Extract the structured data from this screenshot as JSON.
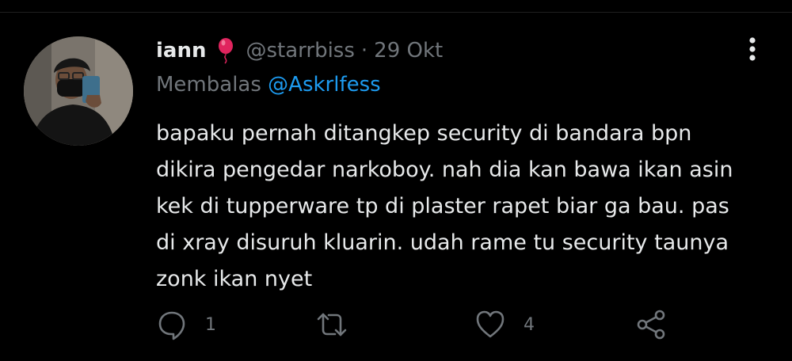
{
  "tweet": {
    "display_name": "iann",
    "handle": "@starrbiss",
    "separator": "·",
    "time": "29 Okt",
    "reply_prefix": "Membalas",
    "reply_to": "@Askrlfess",
    "text": "bapaku pernah ditangkep security di bandara bpn\ndikira pengedar narkoboy. nah dia kan bawa ikan asin\nkek di tupperware tp di plaster rapet biar ga bau. pas\ndi xray disuruh kluarin. udah rame tu security taunya\nzonk ikan nyet"
  },
  "actions": {
    "reply_count": "1",
    "retweet_count": "",
    "like_count": "4"
  },
  "icons": {
    "reply": "reply-icon",
    "retweet": "retweet-icon",
    "like": "heart-icon",
    "share": "share-icon",
    "more": "more-vertical-icon",
    "emoji": "balloon-emoji"
  },
  "colors": {
    "background": "#000000",
    "text": "#e7e9ea",
    "muted": "#71767b",
    "link": "#1d9bf0",
    "emoji": "#e0245e"
  }
}
